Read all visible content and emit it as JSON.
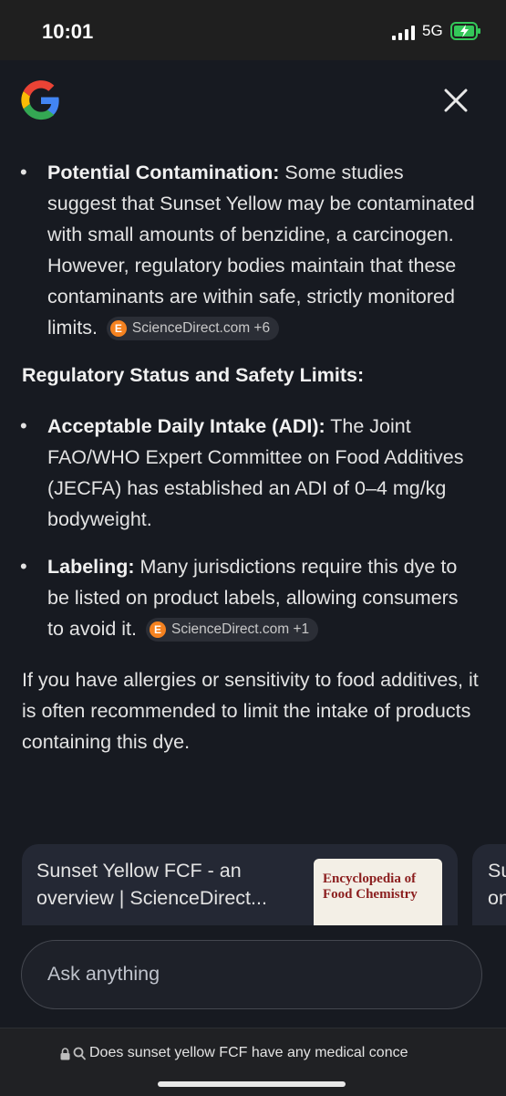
{
  "status_bar": {
    "time": "10:01",
    "network": "5G"
  },
  "content": {
    "bullets_1": [
      {
        "label": "Potential Contamination:",
        "text": " Some studies suggest that Sunset Yellow may be contaminated with small amounts of benzidine, a carcinogen. However, regulatory bodies maintain that these contaminants are within safe, strictly monitored limits.",
        "chip": "ScienceDirect.com +6"
      }
    ],
    "heading": "Regulatory Status and Safety Limits:",
    "bullets_2": [
      {
        "label": "Acceptable Daily Intake (ADI):",
        "text": " The Joint FAO/WHO Expert Committee on Food Additives (JECFA) has established an ADI of 0–4 mg/kg bodyweight."
      },
      {
        "label": "Labeling:",
        "text": " Many jurisdictions require this dye to be listed on product labels, allowing consumers to avoid it.",
        "chip": "ScienceDirect.com +1"
      }
    ],
    "closing": "If you have allergies or sensitivity to food additives, it is often recommended to limit the intake of products containing this dye."
  },
  "source_card": {
    "title": "Sunset Yellow FCF - an overview | ScienceDirect...",
    "thumb_title": "Encyclopedia of Food Chemistry",
    "next_card_partial": "Su\non"
  },
  "ask": {
    "placeholder": "Ask anything"
  },
  "url_bar": {
    "text": "Does sunset yellow FCF have any medical conce"
  },
  "colors": {
    "background": "#171a21",
    "chip_icon": "#f58220"
  },
  "icons": [
    "google-logo",
    "close-icon",
    "sciencedirect-icon",
    "lock-icon",
    "search-icon",
    "signal-icon",
    "battery-charging-icon"
  ]
}
